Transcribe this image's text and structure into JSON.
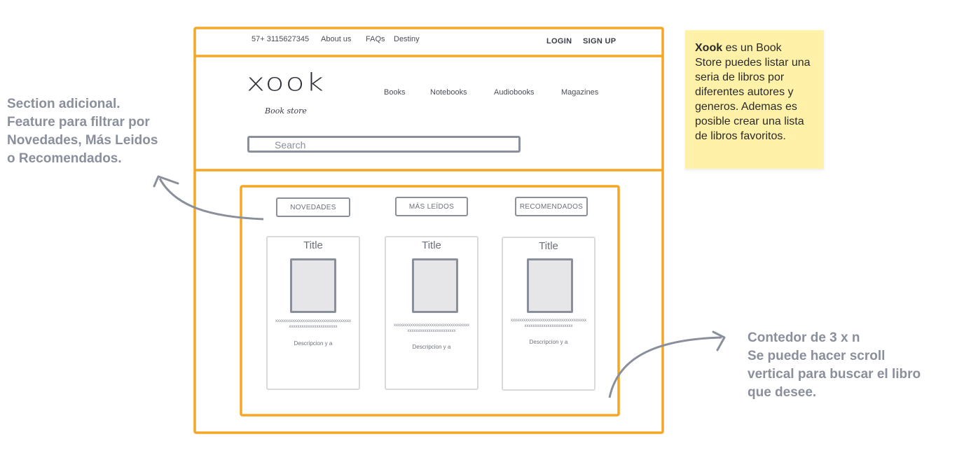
{
  "topbar": {
    "phone": "57+ 3115627345",
    "about": "About us",
    "faqs": "FAQs",
    "destiny": "Destiny",
    "login": "LOGIN",
    "signup": "SIGN UP"
  },
  "brand": {
    "logo": "xook",
    "tagline": "Book store"
  },
  "nav": {
    "items": [
      "Books",
      "Notebooks",
      "Audiobooks",
      "Magazines"
    ]
  },
  "search": {
    "placeholder": "Search"
  },
  "filters": [
    "NOVEDADES",
    "MÁS LEÍDOS",
    "RECOMENDADOS"
  ],
  "cards": [
    {
      "title": "Title",
      "filler": "xxxxxxxxxxxxxxxxxxxxxxxxxxxxxxxxxxxxxxxxxxxxxxxxxxxxxxxxxxx",
      "desc": "Descripcion y a"
    },
    {
      "title": "Title",
      "filler": "xxxxxxxxxxxxxxxxxxxxxxxxxxxxxxxxxxxxxxxxxxxxxxxxxxxxxxxxxxx",
      "desc": "Descripcion y a"
    },
    {
      "title": "Title",
      "filler": "xxxxxxxxxxxxxxxxxxxxxxxxxxxxxxxxxxxxxxxxxxxxxxxxxxxxxxxxxxx",
      "desc": "Descripcion y a"
    }
  ],
  "annotations": {
    "left": [
      "Section adicional.",
      "Feature para filtrar por",
      "Novedades, Más Leidos",
      "o Recomendados."
    ],
    "right": [
      "Contedor de 3 x n",
      "Se puede hacer scroll",
      "vertical para buscar el libro",
      "que desee."
    ],
    "sticky_bold": "Xook",
    "sticky_text": " es un Book Store puedes listar una seria de libros por diferentes autores y generos. Ademas es posible crear una lista de libros favoritos."
  },
  "colors": {
    "frame": "#f5a623",
    "sketch": "#8a8f9c",
    "sticky": "#fff2a8"
  }
}
